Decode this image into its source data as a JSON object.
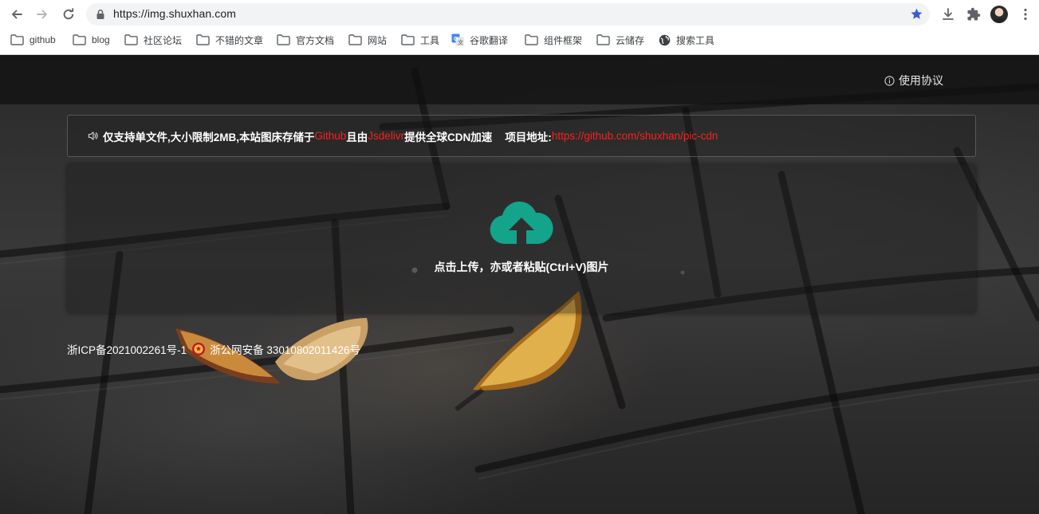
{
  "browser": {
    "url": "https://img.shuxhan.com",
    "bookmarks": [
      {
        "label": "github",
        "icon": "folder-icon"
      },
      {
        "label": "blog",
        "icon": "folder-icon"
      },
      {
        "label": "社区论坛",
        "icon": "folder-icon"
      },
      {
        "label": "不错的文章",
        "icon": "folder-icon"
      },
      {
        "label": "官方文档",
        "icon": "folder-icon"
      },
      {
        "label": "网站",
        "icon": "folder-icon"
      },
      {
        "label": "工具",
        "icon": "folder-icon"
      },
      {
        "label": "谷歌翻译",
        "icon": "google-translate-icon"
      },
      {
        "label": "组件框架",
        "icon": "folder-icon"
      },
      {
        "label": "云储存",
        "icon": "folder-icon"
      },
      {
        "label": "搜索工具",
        "icon": "globe-icon"
      }
    ]
  },
  "header": {
    "agreement_label": "使用协议"
  },
  "notice": {
    "text_1": "仅支持单文件,大小限制2MB,本站图床存储于",
    "link_github": "Github",
    "text_2": "且由",
    "link_jsdelivr": "Jsdelivr",
    "text_3": "提供全球CDN加速",
    "project_label": "项目地址:",
    "project_url": "https://github.com/shuxhan/pic-cdn"
  },
  "upload": {
    "hint": "点击上传，亦或者粘贴(Ctrl+V)图片"
  },
  "footer": {
    "icp": "浙ICP备2021002261号-1",
    "police": "浙公网安备 33010802011426号"
  },
  "colors": {
    "accent": "#14a38b",
    "link_red": "#ff1e1e",
    "star_blue": "#3b5bdb"
  }
}
